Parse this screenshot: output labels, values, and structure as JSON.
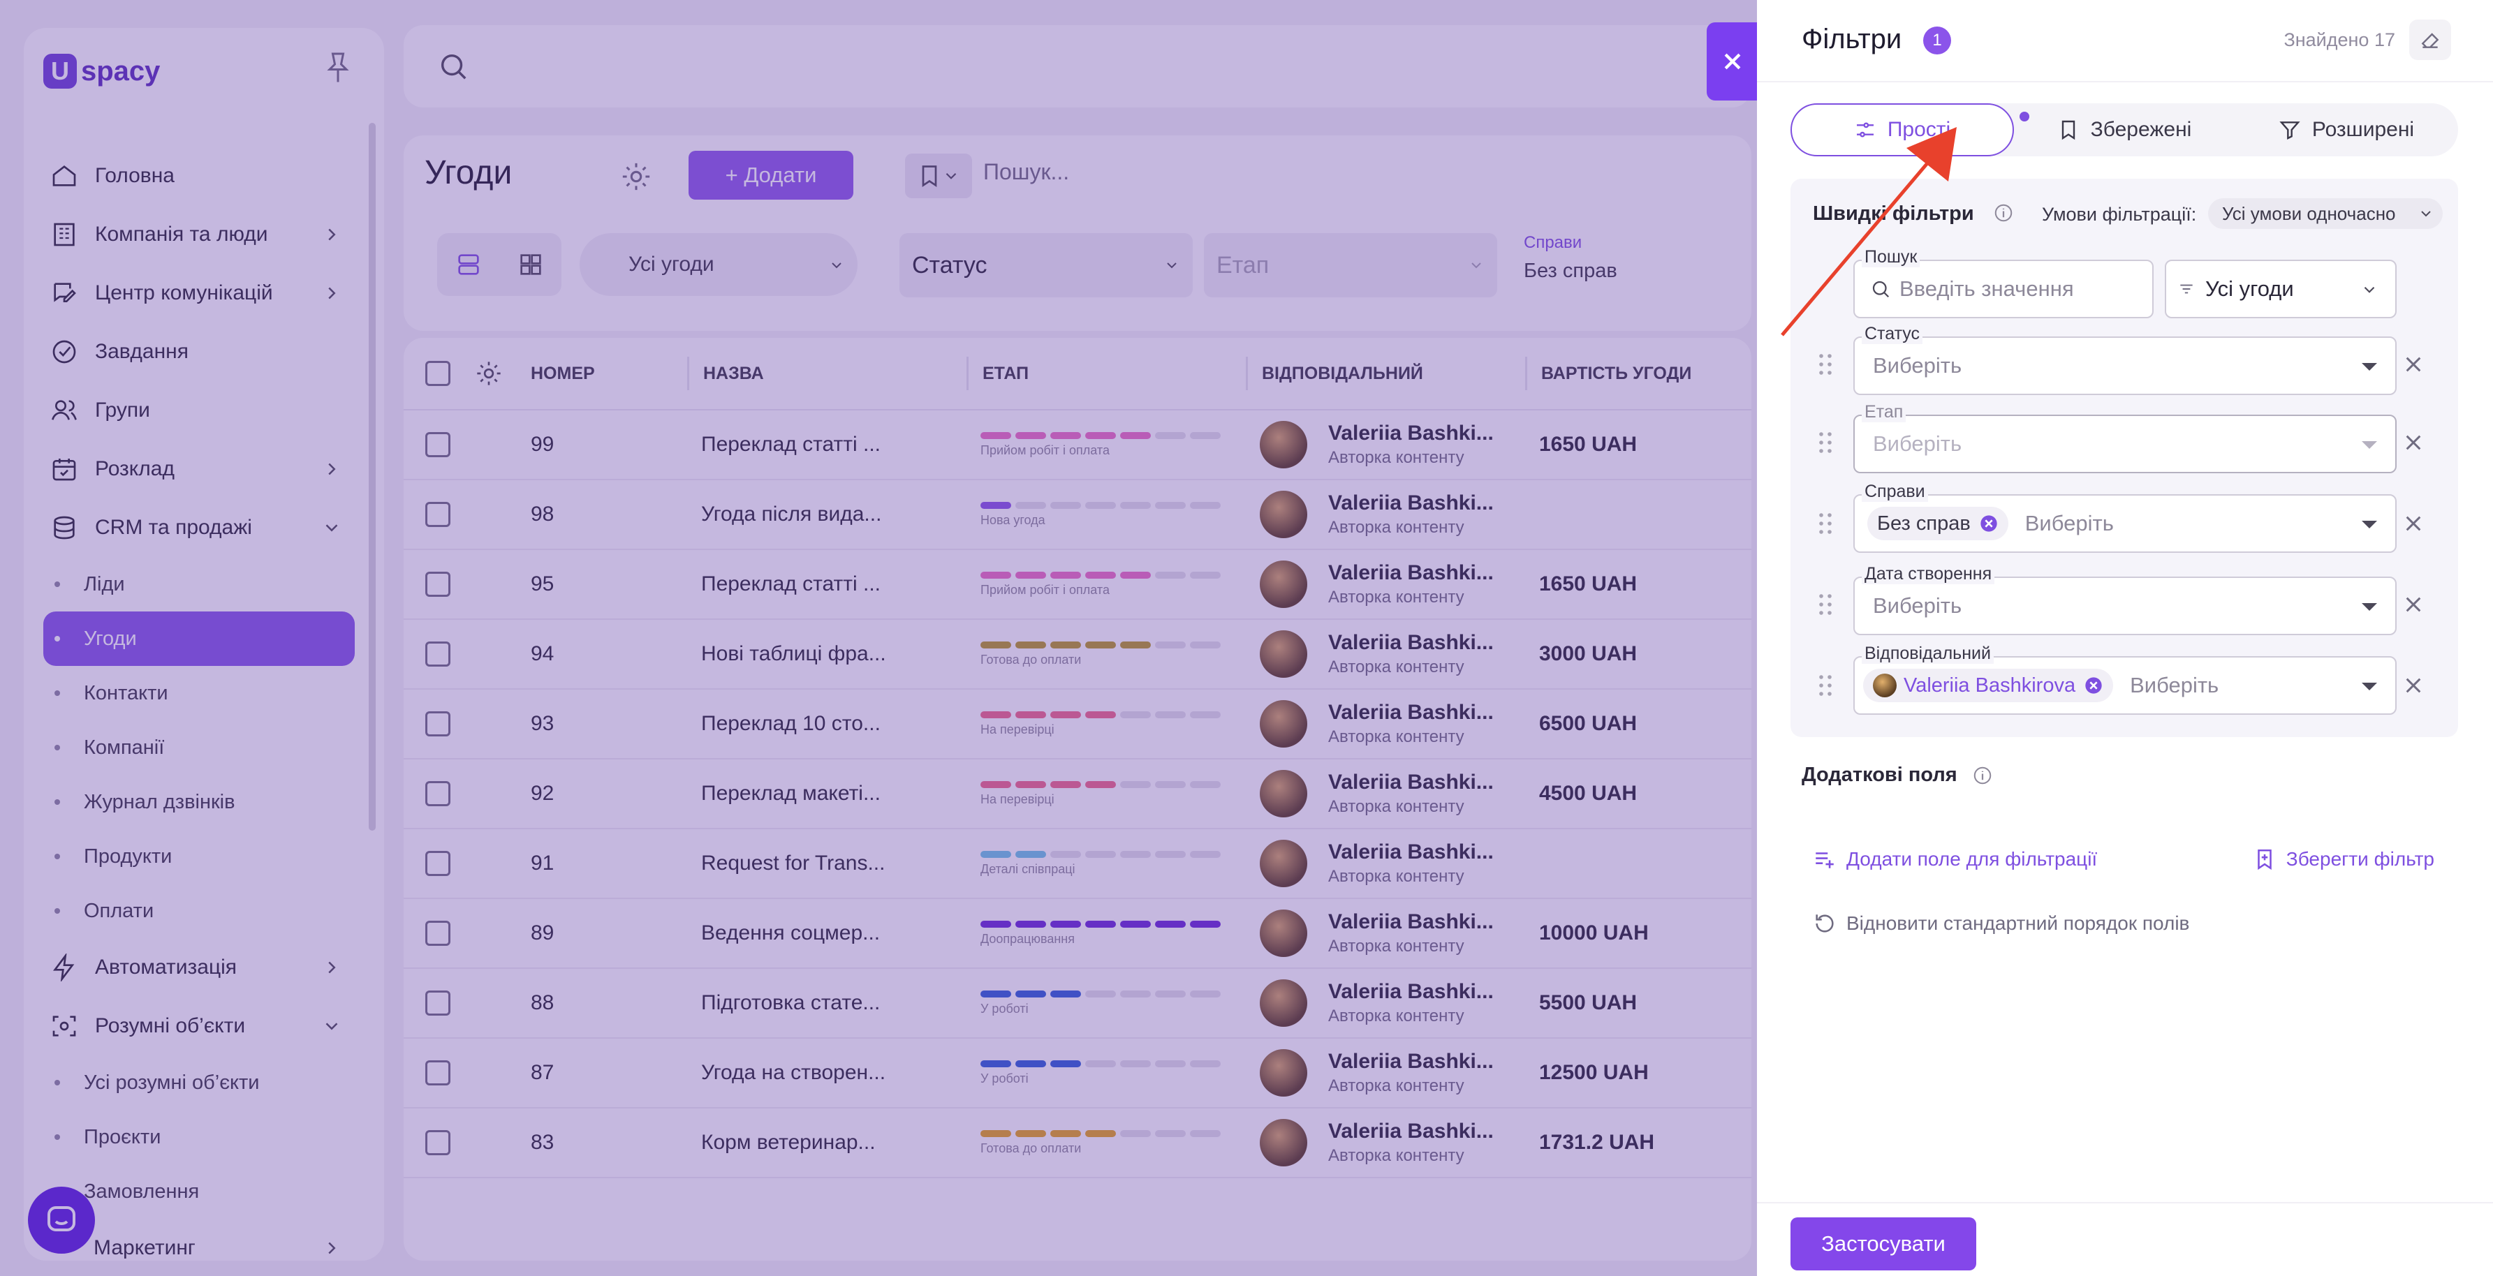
{
  "sidebar": {
    "logo_mark": "U",
    "logo_text": "spacy",
    "items": [
      {
        "label": "Головна",
        "icon": "home-icon"
      },
      {
        "label": "Компанія та люди",
        "icon": "building-icon"
      },
      {
        "label": "Центр комунікацій",
        "icon": "chat-edit-icon"
      },
      {
        "label": "Завдання",
        "icon": "check-circle-icon"
      },
      {
        "label": "Групи",
        "icon": "users-icon"
      },
      {
        "label": "Розклад",
        "icon": "calendar-icon"
      },
      {
        "label": "CRM та продажі",
        "icon": "database-icon"
      }
    ],
    "crm_sub": [
      "Ліди",
      "Угоди",
      "Контакти",
      "Компанії",
      "Журнал дзвінків",
      "Продукти",
      "Оплати"
    ],
    "automation": "Автоматизація",
    "smart_objects": "Розумні об’єкти",
    "smart_sub": [
      "Усі розумні об’єкти",
      "Проєкти",
      "Замовлення"
    ],
    "marketing": "Маркетинг"
  },
  "deals": {
    "title": "Угоди",
    "add_label": "+ Додати",
    "search_placeholder": "Пошук...",
    "view_filter": "Усі угоди",
    "status_label": "Статус",
    "stage_label": "Етап",
    "affairs_label": "Справи",
    "affairs_value": "Без справ"
  },
  "table": {
    "headers": {
      "number": "НОМЕР",
      "name": "НАЗВА",
      "stage": "ЕТАП",
      "owner": "ВІДПОВІДАЛЬНИЙ",
      "cost": "ВАРТІСТЬ УГОДИ"
    },
    "rows": [
      {
        "num": "99",
        "name": "Переклад статті ...",
        "stage": "Прийом робіт і оплата",
        "filled": 5,
        "color": "#ec6fc0",
        "owner": "Valeriia Bashki...",
        "role": "Авторка контенту",
        "cost": "1650 UAH"
      },
      {
        "num": "98",
        "name": "Угода після вида...",
        "stage": "Нова угода",
        "filled": 1,
        "color": "#8a55e6",
        "owner": "Valeriia Bashki...",
        "role": "Авторка контенту",
        "cost": ""
      },
      {
        "num": "95",
        "name": "Переклад статті ...",
        "stage": "Прийом робіт і оплата",
        "filled": 5,
        "color": "#ec6fc0",
        "owner": "Valeriia Bashki...",
        "role": "Авторка контенту",
        "cost": "1650 UAH"
      },
      {
        "num": "94",
        "name": "Нові таблиці фра...",
        "stage": "Готова до оплати",
        "filled": 5,
        "color": "#b99a28",
        "owner": "Valeriia Bashki...",
        "role": "Авторка контенту",
        "cost": "3000 UAH"
      },
      {
        "num": "93",
        "name": "Переклад 10 сто...",
        "stage": "На перевірці",
        "filled": 4,
        "color": "#ef6a89",
        "owner": "Valeriia Bashki...",
        "role": "Авторка контенту",
        "cost": "6500 UAH"
      },
      {
        "num": "92",
        "name": "Переклад макеті...",
        "stage": "На перевірці",
        "filled": 4,
        "color": "#ef6a89",
        "owner": "Valeriia Bashki...",
        "role": "Авторка контенту",
        "cost": "4500 UAH"
      },
      {
        "num": "91",
        "name": "Request for Trans...",
        "stage": "Деталі співпраці",
        "filled": 2,
        "color": "#6fc6e6",
        "owner": "Valeriia Bashki...",
        "role": "Авторка контенту",
        "cost": ""
      },
      {
        "num": "89",
        "name": "Ведення соцмер...",
        "stage": "Доопрацювання",
        "filled": 7,
        "color": "#6a2ad6",
        "owner": "Valeriia Bashki...",
        "role": "Авторка контенту",
        "cost": "10000 UAH"
      },
      {
        "num": "88",
        "name": "Підготовка стате...",
        "stage": "У роботі",
        "filled": 3,
        "color": "#2f5fd6",
        "owner": "Valeriia Bashki...",
        "role": "Авторка контенту",
        "cost": "5500 UAH"
      },
      {
        "num": "87",
        "name": "Угода на створен...",
        "stage": "У роботі",
        "filled": 3,
        "color": "#2f5fd6",
        "owner": "Valeriia Bashki...",
        "role": "Авторка контенту",
        "cost": "12500 UAH"
      },
      {
        "num": "83",
        "name": "Корм ветеринар...",
        "stage": "Готова до оплати",
        "filled": 4,
        "color": "#e6a51c",
        "owner": "Valeriia Bashki...",
        "role": "Авторка контенту",
        "cost": "1731.2 UAH"
      }
    ]
  },
  "filters": {
    "title": "Фільтри",
    "badge": "1",
    "found": "Знайдено 17",
    "tabs": {
      "simple": "Прості",
      "saved": "Збережені",
      "advanced": "Розширені"
    },
    "quick_title": "Швидкі фільтри",
    "condition_label": "Умови фільтрації:",
    "condition_value": "Усі умови одночасно",
    "search_label": "Пошук",
    "search_placeholder": "Введіть значення",
    "deals_scope": "Усі угоди",
    "status_label": "Статус",
    "stage_label": "Етап",
    "affairs_label": "Справи",
    "affairs_chip": "Без справ",
    "created_label": "Дата створення",
    "owner_label": "Відповідальний",
    "owner_chip": "Valeriia Bashkirova",
    "choose": "Виберіть",
    "extra_title": "Додаткові поля",
    "add_field": "Додати поле для фільтрації",
    "save_filter": "Зберегти фільтр",
    "restore": "Відновити стандартний порядок полів",
    "apply": "Застосувати"
  },
  "colors": {
    "accent": "#7e4fe0",
    "pointer": "#e8412c"
  }
}
